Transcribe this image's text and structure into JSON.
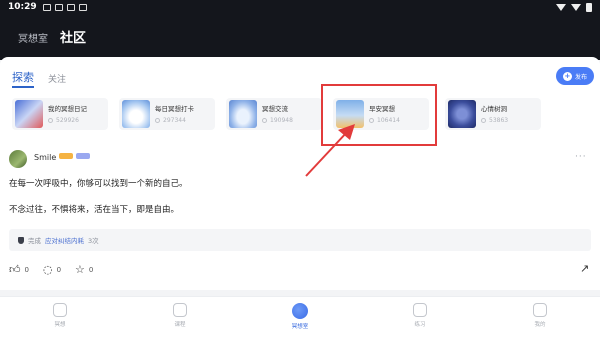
{
  "status_bar": {
    "time": "10:29"
  },
  "header": {
    "tab_meditation_room": "冥想室",
    "tab_community": "社区"
  },
  "subtabs": {
    "explore": "探索",
    "follow": "关注"
  },
  "publish_button": {
    "label": "发布"
  },
  "topics": [
    {
      "name": "我的冥想日记",
      "count": "529926"
    },
    {
      "name": "每日冥想打卡",
      "count": "297344"
    },
    {
      "name": "冥想交流",
      "count": "190948"
    },
    {
      "name": "早安冥想",
      "count": "106414"
    },
    {
      "name": "心情树洞",
      "count": "53863"
    }
  ],
  "post": {
    "username": "Smile",
    "line1": "在每一次呼吸中，你够可以找到一个新的自己。",
    "line2": "不念过往，不惧将来，活在当下，即是自由。",
    "completed_prefix": "完成",
    "completed_link": "应对纠结内耗",
    "completed_suffix": "3次",
    "like_count": "0",
    "comment_count": "0",
    "favorite_count": "0"
  },
  "nav": [
    {
      "label": "冥想",
      "icon": "rocket-icon"
    },
    {
      "label": "课程",
      "icon": "graduation-cap-icon"
    },
    {
      "label": "冥想室",
      "icon": "planet-icon"
    },
    {
      "label": "练习",
      "icon": "note-icon"
    },
    {
      "label": "我的",
      "icon": "profile-icon"
    }
  ],
  "colors": {
    "accent": "#4a7cf6",
    "highlight_box": "#e23b3b",
    "header_bg": "#14161c"
  }
}
